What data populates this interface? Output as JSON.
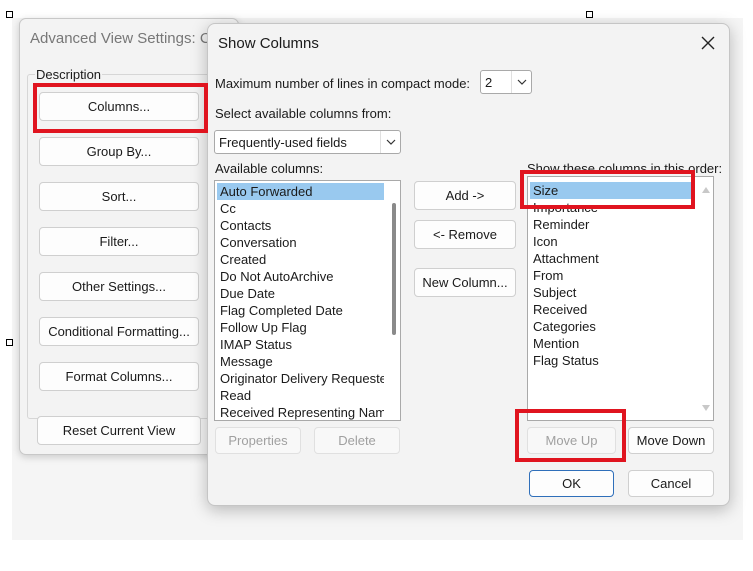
{
  "back_window": {
    "title": "Advanced View Settings: Co",
    "group_label": "Description",
    "buttons": {
      "columns": "Columns...",
      "group_by": "Group By...",
      "sort": "Sort...",
      "filter": "Filter...",
      "other_settings": "Other Settings...",
      "conditional_formatting": "Conditional Formatting...",
      "format_columns": "Format Columns...",
      "reset_current_view": "Reset Current View"
    }
  },
  "dialog": {
    "title": "Show Columns",
    "max_lines_label": "Maximum number of lines in compact mode:",
    "max_lines_value": "2",
    "select_from_label": "Select available columns from:",
    "select_from_value": "Frequently-used fields",
    "available_label": "Available columns:",
    "available_columns": [
      "Auto Forwarded",
      "Cc",
      "Contacts",
      "Conversation",
      "Created",
      "Do Not AutoArchive",
      "Due Date",
      "Flag Completed Date",
      "Follow Up Flag",
      "IMAP Status",
      "Message",
      "Originator Delivery Requested",
      "Read",
      "Received Representing Name"
    ],
    "available_selected": "Auto Forwarded",
    "show_label": "Show these columns in this order:",
    "show_columns": [
      "Size",
      "Importance",
      "Reminder",
      "Icon",
      "Attachment",
      "From",
      "Subject",
      "Received",
      "Categories",
      "Mention",
      "Flag Status"
    ],
    "show_selected": "Size",
    "buttons": {
      "add": "Add ->",
      "remove": "<- Remove",
      "new_column": "New Column...",
      "properties": "Properties",
      "delete": "Delete",
      "move_up": "Move Up",
      "move_down": "Move Down",
      "ok": "OK",
      "cancel": "Cancel"
    }
  },
  "colors": {
    "highlight": "#e0141f",
    "selection": "#99c9ef",
    "primary_border": "#2f6fba"
  }
}
